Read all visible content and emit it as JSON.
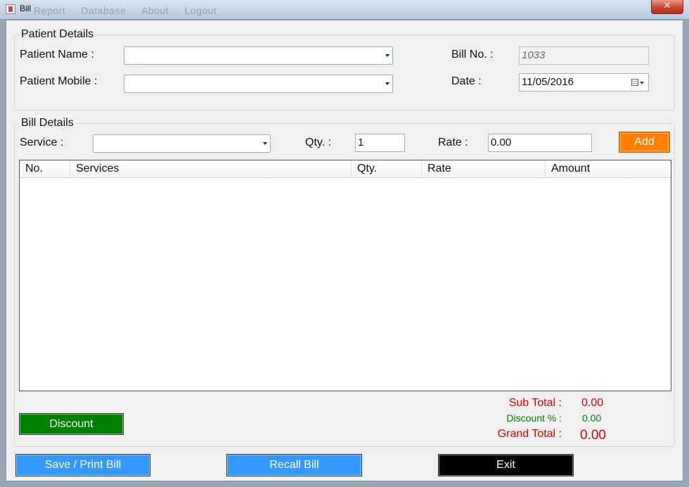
{
  "window": {
    "title": "Bill",
    "background_menu": [
      "Report",
      "Database",
      "About",
      "Logout"
    ],
    "close_glyph": "✕"
  },
  "patient": {
    "group_title": "Patient Details",
    "name_label": "Patient Name :",
    "name_value": "",
    "mobile_label": "Patient Mobile :",
    "mobile_value": "",
    "bill_no_label": "Bill No. :",
    "bill_no_value": "1033",
    "date_label": "Date :",
    "date_value": "11/05/2016"
  },
  "bill": {
    "group_title": "Bill Details",
    "service_label": "Service :",
    "service_value": "",
    "qty_label": "Qty. :",
    "qty_value": "1",
    "rate_label": "Rate :",
    "rate_value": "0.00",
    "add_label": "Add",
    "columns": [
      "No.",
      "Services",
      "Qty.",
      "Rate",
      "Amount"
    ],
    "rows": []
  },
  "totals": {
    "discount_button": "Discount",
    "sub_total_label": "Sub Total :",
    "sub_total_value": "0.00",
    "discount_label": "Discount % :",
    "discount_value": "0.00",
    "grand_total_label": "Grand Total :",
    "grand_total_value": "0.00"
  },
  "actions": {
    "save_print": "Save / Print Bill",
    "recall": "Recall Bill",
    "exit": "Exit"
  },
  "colors": {
    "add_button": "#ff7f00",
    "discount_button": "#008000",
    "action_button": "#3399ff",
    "exit_button": "#000000",
    "sub_total": "#e00000",
    "discount_text": "#008000",
    "grand_total": "#e00000"
  }
}
